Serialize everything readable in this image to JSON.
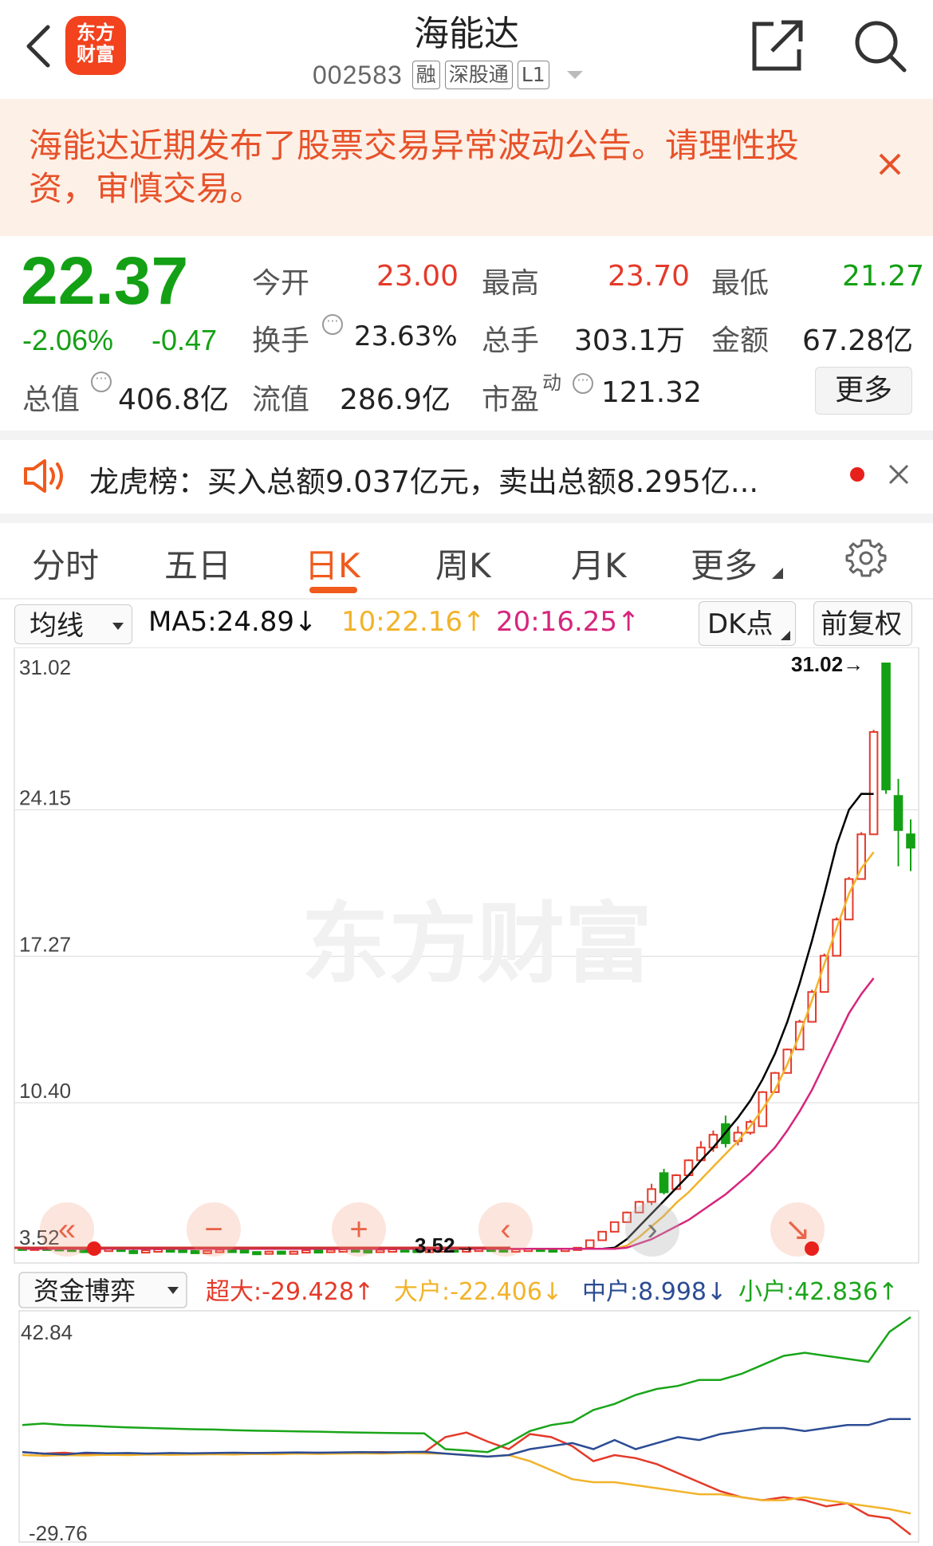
{
  "header": {
    "title": "海能达",
    "code": "002583",
    "tags": [
      "融",
      "深股通",
      "L1"
    ],
    "logo_text": [
      "东方",
      "财富"
    ]
  },
  "notice": {
    "text": "海能达近期发布了股票交易异常波动公告。请理性投资，审慎交易。"
  },
  "quote": {
    "price": "22.37",
    "change_pct": "-2.06%",
    "change": "-0.47",
    "rows": [
      {
        "label": "今开",
        "value": "23.00",
        "color": "red"
      },
      {
        "label": "最高",
        "value": "23.70",
        "color": "red"
      },
      {
        "label": "最低",
        "value": "21.27",
        "color": "green"
      },
      {
        "label": "换手",
        "value": "23.63%",
        "color": "black"
      },
      {
        "label": "总手",
        "value": "303.1万",
        "color": "black"
      },
      {
        "label": "金额",
        "value": "67.28亿",
        "color": "black"
      },
      {
        "label": "总值",
        "value": "406.8亿",
        "color": "black"
      },
      {
        "label": "流值",
        "value": "286.9亿",
        "color": "black"
      },
      {
        "label": "市盈",
        "superscript": "动",
        "value": "121.32",
        "color": "black"
      }
    ],
    "more_label": "更多"
  },
  "ticker": {
    "text": "龙虎榜：买入总额9.037亿元，卖出总额8.295亿..."
  },
  "tabs": [
    {
      "label": "分时"
    },
    {
      "label": "五日"
    },
    {
      "label": "日K",
      "active": true
    },
    {
      "label": "周K"
    },
    {
      "label": "月K"
    },
    {
      "label": "更多"
    }
  ],
  "ma_bar": {
    "selector": "均线",
    "ma5": "MA5:24.89↓",
    "ma10": "10:22.16↑",
    "ma20": "20:16.25↑",
    "dk_label": "DK点",
    "adjust_label": "前复权"
  },
  "kline": {
    "y_labels": [
      "31.02",
      "24.15",
      "17.27",
      "10.40",
      "3.52"
    ],
    "max_marker": "31.02→",
    "min_marker": "3.52→",
    "watermark": "东方财富",
    "zoom_buttons": [
      "«",
      "−",
      "+",
      "‹",
      "›",
      "↘"
    ]
  },
  "fund_bar": {
    "selector": "资金博弈",
    "super_large": "超大:-29.428↑",
    "large": "大户:-22.406↓",
    "medium": "中户:8.998↓",
    "small": "小户:42.836↑"
  },
  "fund_chart": {
    "y_top": "42.84",
    "y_bottom": "-29.76"
  },
  "colors": {
    "up": "#e43a2a",
    "down": "#14a014",
    "accent": "#f05a1c",
    "ma5": "#000000",
    "ma10": "#f2b32a",
    "ma20": "#d6267d",
    "medium": "#2c4c94",
    "small": "#1aa51a"
  },
  "chart_data": [
    {
      "type": "candlestick",
      "title": "日K",
      "ylim": [
        3.52,
        31.02
      ],
      "y_ticks": [
        3.52,
        10.4,
        17.27,
        24.15,
        31.02
      ],
      "series": [
        {
          "name": "MA5",
          "values": [
            3.55,
            3.55,
            3.55,
            3.55,
            3.55,
            3.55,
            3.55,
            3.55,
            3.55,
            3.55,
            3.55,
            3.55,
            3.55,
            3.55,
            3.55,
            3.55,
            3.55,
            3.55,
            3.55,
            3.55,
            3.55,
            3.55,
            3.55,
            3.55,
            3.55,
            3.55,
            3.55,
            3.55,
            3.55,
            3.55,
            3.55,
            3.55,
            3.55,
            3.55,
            3.55,
            3.55,
            3.55,
            3.55,
            3.55,
            3.55,
            3.55,
            3.55,
            3.55,
            3.55,
            3.55,
            3.55,
            3.55,
            3.55,
            3.6,
            4.0,
            4.6,
            5.2,
            5.8,
            6.4,
            7.0,
            7.7,
            8.3,
            9.0,
            9.7,
            10.5,
            11.5,
            12.7,
            14.2,
            16.0,
            18.0,
            20.2,
            22.5,
            24.15,
            24.9,
            24.89
          ]
        },
        {
          "name": "MA10",
          "values": [
            3.55,
            3.55,
            3.55,
            3.55,
            3.55,
            3.55,
            3.55,
            3.55,
            3.55,
            3.55,
            3.55,
            3.55,
            3.55,
            3.55,
            3.55,
            3.55,
            3.55,
            3.55,
            3.55,
            3.55,
            3.55,
            3.55,
            3.55,
            3.55,
            3.55,
            3.55,
            3.55,
            3.55,
            3.55,
            3.55,
            3.55,
            3.55,
            3.55,
            3.55,
            3.55,
            3.55,
            3.55,
            3.55,
            3.55,
            3.55,
            3.55,
            3.55,
            3.55,
            3.55,
            3.55,
            3.55,
            3.55,
            3.55,
            3.55,
            3.7,
            4.1,
            4.6,
            5.1,
            5.7,
            6.2,
            6.8,
            7.4,
            8.0,
            8.6,
            9.3,
            10.1,
            11.0,
            12.2,
            13.6,
            15.2,
            16.9,
            18.6,
            20.2,
            21.4,
            22.16
          ]
        },
        {
          "name": "MA20",
          "values": [
            3.55,
            3.55,
            3.55,
            3.55,
            3.55,
            3.55,
            3.55,
            3.55,
            3.55,
            3.55,
            3.55,
            3.55,
            3.55,
            3.55,
            3.55,
            3.55,
            3.55,
            3.55,
            3.55,
            3.55,
            3.55,
            3.55,
            3.55,
            3.55,
            3.55,
            3.55,
            3.55,
            3.55,
            3.55,
            3.55,
            3.55,
            3.55,
            3.55,
            3.55,
            3.55,
            3.55,
            3.55,
            3.55,
            3.55,
            3.55,
            3.55,
            3.55,
            3.55,
            3.55,
            3.55,
            3.55,
            3.55,
            3.55,
            3.55,
            3.6,
            3.8,
            4.0,
            4.3,
            4.6,
            4.9,
            5.3,
            5.7,
            6.1,
            6.6,
            7.1,
            7.7,
            8.3,
            9.1,
            10.0,
            11.0,
            12.2,
            13.4,
            14.6,
            15.5,
            16.25
          ]
        }
      ],
      "candles": [
        {
          "o": 3.6,
          "c": 3.55,
          "h": 3.6,
          "l": 3.5
        },
        {
          "o": 3.55,
          "c": 3.6,
          "h": 3.65,
          "l": 3.5
        },
        {
          "o": 3.6,
          "c": 3.58,
          "h": 3.62,
          "l": 3.52
        },
        {
          "o": 3.58,
          "c": 3.55,
          "h": 3.6,
          "l": 3.5
        },
        {
          "o": 3.55,
          "c": 3.5,
          "h": 3.58,
          "l": 3.45
        },
        {
          "o": 3.5,
          "c": 3.45,
          "h": 3.52,
          "l": 3.4
        },
        {
          "o": 3.45,
          "c": 3.5,
          "h": 3.55,
          "l": 3.4
        },
        {
          "o": 3.5,
          "c": 3.55,
          "h": 3.56,
          "l": 3.48
        },
        {
          "o": 3.55,
          "c": 3.45,
          "h": 3.58,
          "l": 3.42
        },
        {
          "o": 3.45,
          "c": 3.42,
          "h": 3.5,
          "l": 3.38
        },
        {
          "o": 3.42,
          "c": 3.48,
          "h": 3.5,
          "l": 3.4
        },
        {
          "o": 3.48,
          "c": 3.52,
          "h": 3.55,
          "l": 3.45
        },
        {
          "o": 3.52,
          "c": 3.5,
          "h": 3.56,
          "l": 3.48
        },
        {
          "o": 3.5,
          "c": 3.45,
          "h": 3.52,
          "l": 3.42
        },
        {
          "o": 3.45,
          "c": 3.4,
          "h": 3.48,
          "l": 3.38
        },
        {
          "o": 3.4,
          "c": 3.45,
          "h": 3.48,
          "l": 3.38
        },
        {
          "o": 3.45,
          "c": 3.5,
          "h": 3.52,
          "l": 3.42
        },
        {
          "o": 3.5,
          "c": 3.48,
          "h": 3.55,
          "l": 3.45
        },
        {
          "o": 3.48,
          "c": 3.4,
          "h": 3.5,
          "l": 3.36
        },
        {
          "o": 3.4,
          "c": 3.35,
          "h": 3.42,
          "l": 3.3
        },
        {
          "o": 3.35,
          "c": 3.42,
          "h": 3.45,
          "l": 3.32
        },
        {
          "o": 3.42,
          "c": 3.38,
          "h": 3.45,
          "l": 3.35
        },
        {
          "o": 3.38,
          "c": 3.42,
          "h": 3.45,
          "l": 3.36
        },
        {
          "o": 3.42,
          "c": 3.48,
          "h": 3.5,
          "l": 3.4
        },
        {
          "o": 3.48,
          "c": 3.45,
          "h": 3.5,
          "l": 3.42
        },
        {
          "o": 3.45,
          "c": 3.5,
          "h": 3.52,
          "l": 3.42
        },
        {
          "o": 3.5,
          "c": 3.52,
          "h": 3.55,
          "l": 3.48
        },
        {
          "o": 3.52,
          "c": 3.48,
          "h": 3.55,
          "l": 3.45
        },
        {
          "o": 3.48,
          "c": 3.45,
          "h": 3.5,
          "l": 3.42
        },
        {
          "o": 3.45,
          "c": 3.5,
          "h": 3.52,
          "l": 3.42
        },
        {
          "o": 3.5,
          "c": 3.52,
          "h": 3.55,
          "l": 3.48
        },
        {
          "o": 3.52,
          "c": 3.5,
          "h": 3.55,
          "l": 3.48
        },
        {
          "o": 3.5,
          "c": 3.48,
          "h": 3.52,
          "l": 3.46
        },
        {
          "o": 3.48,
          "c": 3.5,
          "h": 3.52,
          "l": 3.46
        },
        {
          "o": 3.5,
          "c": 3.52,
          "h": 3.54,
          "l": 3.48
        },
        {
          "o": 3.52,
          "c": 3.5,
          "h": 3.54,
          "l": 3.48
        },
        {
          "o": 3.5,
          "c": 3.52,
          "h": 3.55,
          "l": 3.48
        },
        {
          "o": 3.52,
          "c": 3.55,
          "h": 3.56,
          "l": 3.5
        },
        {
          "o": 3.55,
          "c": 3.52,
          "h": 3.56,
          "l": 3.5
        },
        {
          "o": 3.52,
          "c": 3.5,
          "h": 3.54,
          "l": 3.48
        },
        {
          "o": 3.5,
          "c": 3.52,
          "h": 3.54,
          "l": 3.48
        },
        {
          "o": 3.52,
          "c": 3.55,
          "h": 3.56,
          "l": 3.5
        },
        {
          "o": 3.55,
          "c": 3.52,
          "h": 3.56,
          "l": 3.5
        },
        {
          "o": 3.52,
          "c": 3.5,
          "h": 3.54,
          "l": 3.48
        },
        {
          "o": 3.5,
          "c": 3.55,
          "h": 3.56,
          "l": 3.5
        },
        {
          "o": 3.55,
          "c": 3.6,
          "h": 3.62,
          "l": 3.52
        },
        {
          "o": 3.6,
          "c": 3.95,
          "h": 3.96,
          "l": 3.6
        },
        {
          "o": 3.95,
          "c": 4.35,
          "h": 4.36,
          "l": 3.95
        },
        {
          "o": 4.35,
          "c": 4.8,
          "h": 4.82,
          "l": 4.35
        },
        {
          "o": 4.8,
          "c": 5.25,
          "h": 5.3,
          "l": 4.8
        },
        {
          "o": 5.25,
          "c": 5.75,
          "h": 5.8,
          "l": 5.25
        },
        {
          "o": 5.75,
          "c": 6.35,
          "h": 6.6,
          "l": 5.6
        },
        {
          "o": 7.1,
          "c": 6.2,
          "h": 7.3,
          "l": 6.1
        },
        {
          "o": 6.35,
          "c": 7.0,
          "h": 7.05,
          "l": 6.3
        },
        {
          "o": 7.0,
          "c": 7.7,
          "h": 7.75,
          "l": 7.0
        },
        {
          "o": 7.7,
          "c": 8.3,
          "h": 8.6,
          "l": 7.7
        },
        {
          "o": 8.3,
          "c": 8.9,
          "h": 9.1,
          "l": 8.1
        },
        {
          "o": 9.4,
          "c": 8.5,
          "h": 9.8,
          "l": 8.3
        },
        {
          "o": 8.6,
          "c": 9.0,
          "h": 9.3,
          "l": 8.4
        },
        {
          "o": 9.0,
          "c": 9.5,
          "h": 9.6,
          "l": 8.9
        },
        {
          "o": 9.3,
          "c": 10.9,
          "h": 10.95,
          "l": 9.3
        },
        {
          "o": 10.9,
          "c": 11.8,
          "h": 11.85,
          "l": 10.9
        },
        {
          "o": 11.8,
          "c": 12.9,
          "h": 12.95,
          "l": 11.8
        },
        {
          "o": 12.9,
          "c": 14.2,
          "h": 14.3,
          "l": 12.9
        },
        {
          "o": 14.2,
          "c": 15.6,
          "h": 15.7,
          "l": 14.2
        },
        {
          "o": 15.6,
          "c": 17.3,
          "h": 17.4,
          "l": 15.6
        },
        {
          "o": 17.3,
          "c": 19.0,
          "h": 19.1,
          "l": 17.3
        },
        {
          "o": 19.0,
          "c": 20.9,
          "h": 21.0,
          "l": 19.0
        },
        {
          "o": 20.9,
          "c": 23.0,
          "h": 23.1,
          "l": 20.9
        },
        {
          "o": 23.0,
          "c": 27.8,
          "h": 27.9,
          "l": 23.0
        },
        {
          "o": 31.02,
          "c": 25.1,
          "h": 31.02,
          "l": 24.9
        },
        {
          "o": 24.8,
          "c": 23.2,
          "h": 25.6,
          "l": 21.5
        },
        {
          "o": 23.0,
          "c": 22.37,
          "h": 23.7,
          "l": 21.27
        }
      ]
    },
    {
      "type": "line",
      "title": "资金博弈",
      "ylim": [
        -29.76,
        42.84
      ],
      "series": [
        {
          "name": "超大",
          "values": [
            -2,
            -2.5,
            -2.2,
            -2.8,
            -2.6,
            -2.7,
            -2.5,
            -2.4,
            -2.6,
            -2.5,
            -2.4,
            -2.3,
            -2.5,
            -2.4,
            -2.2,
            -2.3,
            -2.1,
            -2.0,
            -2.2,
            -2.1,
            3,
            4.5,
            1.5,
            -1,
            4,
            3,
            0,
            -5,
            -3,
            -4,
            -6,
            -9,
            -12,
            -15,
            -17,
            -18,
            -17,
            -18,
            -20,
            -19,
            -23,
            -24,
            -29.428
          ]
        },
        {
          "name": "大户",
          "values": [
            -3,
            -3.2,
            -3.0,
            -3.1,
            -2.9,
            -3.0,
            -2.8,
            -2.9,
            -2.8,
            -2.7,
            -2.8,
            -2.6,
            -2.7,
            -2.5,
            -2.6,
            -2.5,
            -2.4,
            -2.5,
            -2.3,
            -2.4,
            -2.5,
            -3,
            -3.5,
            -3,
            -5,
            -8,
            -11,
            -12,
            -12,
            -13,
            -14,
            -15,
            -16,
            -16,
            -17,
            -18,
            -18,
            -17,
            -18,
            -19,
            -20,
            -21,
            -22.406
          ]
        },
        {
          "name": "中户",
          "values": [
            -2,
            -2.5,
            -2.8,
            -2.2,
            -2.4,
            -2.3,
            -2.5,
            -2.3,
            -2.4,
            -2.3,
            -2.2,
            -2.3,
            -2.2,
            -2.1,
            -2.2,
            -2.1,
            -2.0,
            -2.1,
            -2.0,
            -1.9,
            -2.5,
            -3,
            -3.5,
            -3,
            -1,
            0,
            1,
            -1,
            2,
            -1,
            1,
            3,
            2,
            4,
            5,
            6,
            6,
            5,
            6,
            7,
            7,
            9,
            8.998
          ]
        },
        {
          "name": "小户",
          "values": [
            7,
            7.5,
            7,
            6.8,
            6.5,
            6.2,
            6.0,
            5.8,
            5.6,
            5.5,
            5.3,
            5.1,
            5.0,
            4.9,
            4.8,
            4.6,
            4.5,
            4.4,
            4.3,
            4.2,
            -1,
            -1.5,
            -2,
            1,
            5,
            7,
            8,
            12,
            14,
            17,
            19,
            20,
            22,
            22,
            24,
            27,
            30,
            31,
            30,
            29,
            28,
            38,
            42.836
          ]
        }
      ]
    }
  ]
}
